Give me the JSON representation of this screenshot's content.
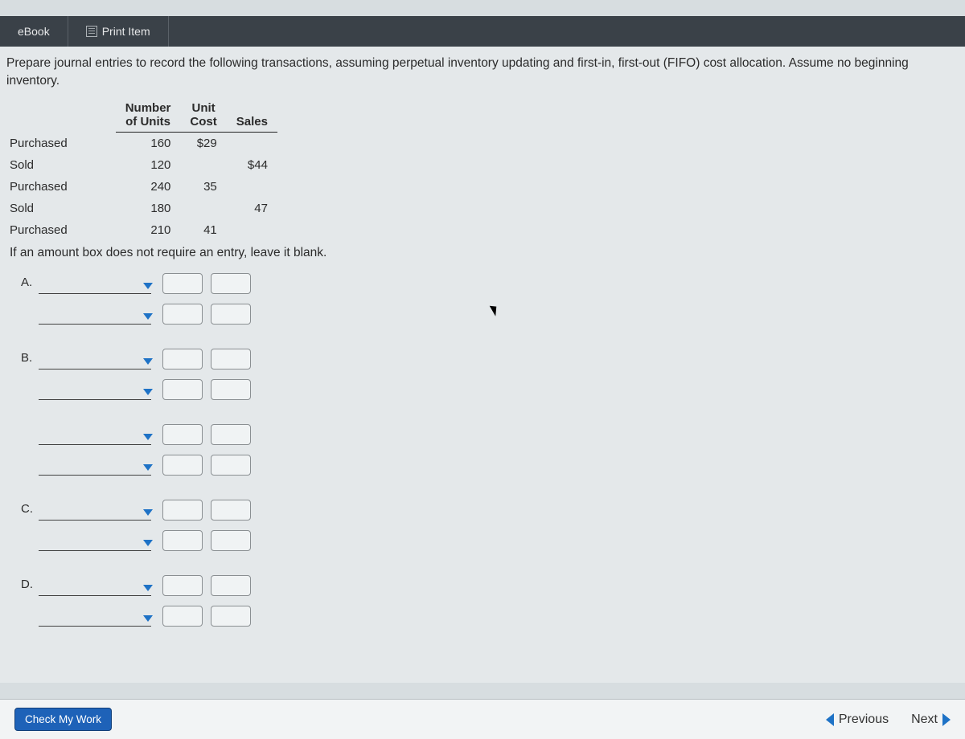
{
  "toolbar": {
    "ebook_label": "eBook",
    "print_label": "Print Item"
  },
  "instructions_line1": "Prepare journal entries to record the following transactions, assuming perpetual inventory updating and first-in, first-out (FIFO) cost allocation. Assume no beginning",
  "instructions_line2": "inventory.",
  "table": {
    "headers": {
      "units_l1": "Number",
      "units_l2": "of Units",
      "cost_l1": "Unit",
      "cost_l2": "Cost",
      "sales": "Sales"
    },
    "rows": [
      {
        "label": "Purchased",
        "units": "160",
        "cost": "$29",
        "sales": ""
      },
      {
        "label": "Sold",
        "units": "120",
        "cost": "",
        "sales": "$44"
      },
      {
        "label": "Purchased",
        "units": "240",
        "cost": "35",
        "sales": ""
      },
      {
        "label": "Sold",
        "units": "180",
        "cost": "",
        "sales": "47"
      },
      {
        "label": "Purchased",
        "units": "210",
        "cost": "41",
        "sales": ""
      }
    ]
  },
  "note": "If an amount box does not require an entry, leave it blank.",
  "entries": {
    "labels": [
      "A.",
      "B.",
      "C.",
      "D."
    ]
  },
  "footer": {
    "check_label": "Check My Work",
    "prev_label": "Previous",
    "next_label": "Next"
  }
}
